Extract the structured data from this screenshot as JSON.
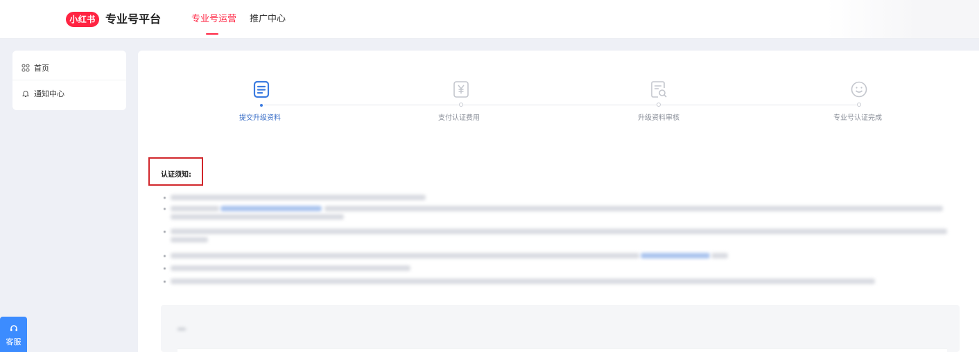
{
  "header": {
    "logo_text": "小红书",
    "brand": "专业号平台",
    "nav": [
      {
        "label": "专业号运营",
        "active": true
      },
      {
        "label": "推广中心",
        "active": false
      }
    ]
  },
  "sidebar": {
    "items": [
      {
        "label": "首页",
        "icon": "grid-icon"
      },
      {
        "label": "通知中心",
        "icon": "bell-icon"
      }
    ]
  },
  "support": {
    "label": "客服",
    "icon": "headset-icon"
  },
  "steps": [
    {
      "label": "提交升级资料",
      "icon": "document-icon",
      "active": true
    },
    {
      "label": "支付认证费用",
      "icon": "yuan-receipt-icon",
      "active": false
    },
    {
      "label": "升级资料审核",
      "icon": "document-search-icon",
      "active": false
    },
    {
      "label": "专业号认证完成",
      "icon": "smiley-icon",
      "active": false
    }
  ],
  "notice": {
    "title": "认证须知:"
  },
  "colors": {
    "brand_red": "#ff2442",
    "active_blue": "#3b7be0",
    "highlight_box": "#d1262b",
    "support_blue": "#3c8cff"
  }
}
